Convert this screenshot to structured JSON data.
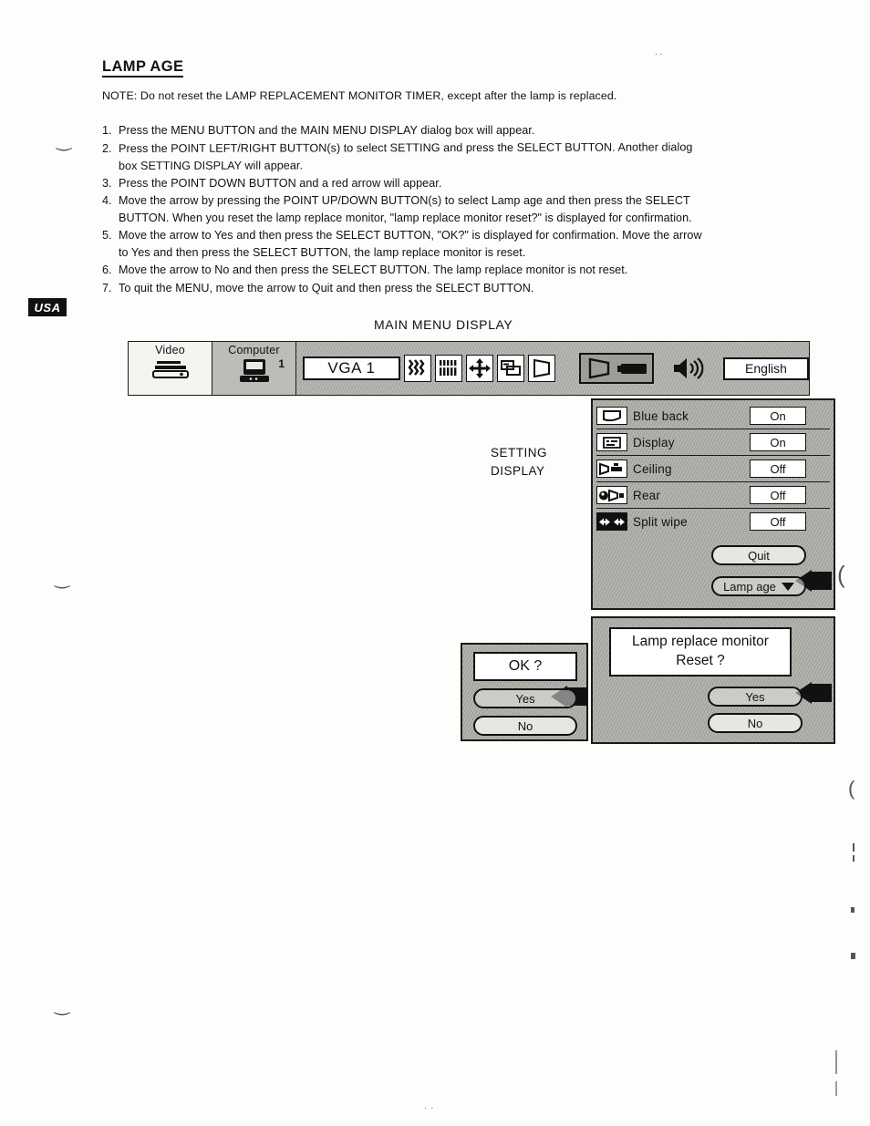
{
  "document": {
    "heading": "LAMP AGE",
    "note": "NOTE: Do not reset the LAMP REPLACEMENT MONITOR TIMER, except  after the lamp is replaced.",
    "region_badge": "USA",
    "top_artifact": ". .",
    "bottom_artifact": ". ."
  },
  "steps": [
    {
      "num": "1.",
      "lines": [
        "Press the MENU BUTTON and the MAIN MENU DISPLAY dialog box will appear."
      ]
    },
    {
      "num": "2.",
      "lines": [
        "Press the POINT LEFT/RIGHT BUTTON(s) to select SETTING and press the SELECT BUTTON. Another dialog",
        "box SETTING DISPLAY will appear."
      ]
    },
    {
      "num": "3.",
      "lines": [
        "Press the POINT DOWN BUTTON and a red arrow will appear."
      ]
    },
    {
      "num": "4.",
      "lines": [
        "Move the arrow by pressing the POINT UP/DOWN BUTTON(s) to select Lamp age and then press the SELECT",
        "BUTTON. When you reset the lamp replace monitor, \"lamp replace monitor reset?\" is displayed for confirmation."
      ]
    },
    {
      "num": "5.",
      "lines": [
        "Move the arrow to Yes and then press the SELECT BUTTON, \"OK?\" is displayed for confirmation. Move the arrow",
        "to Yes and then press the SELECT BUTTON, the lamp replace monitor is reset."
      ]
    },
    {
      "num": "6.",
      "lines": [
        "Move the arrow to No and then press the SELECT BUTTON. The lamp replace monitor is not reset."
      ]
    },
    {
      "num": "7.",
      "lines": [
        "To quit the MENU, move the arrow to Quit and then press the SELECT BUTTON."
      ]
    }
  ],
  "figure": {
    "title": "MAIN MENU DISPLAY",
    "setting_display_label_line1": "SETTING",
    "setting_display_label_line2": "DISPLAY",
    "menubar": {
      "tabs": [
        {
          "label": "Video",
          "icon": "video-deck-icon",
          "superscript": "",
          "selected": false
        },
        {
          "label": "Computer",
          "icon": "computer-monitor-icon",
          "superscript": "1",
          "selected": true
        }
      ],
      "source_value": "VGA 1",
      "icons": [
        {
          "name": "fine-sync-icon"
        },
        {
          "name": "total-dots-icon"
        },
        {
          "name": "position-icon"
        },
        {
          "name": "image-adjust-icon"
        },
        {
          "name": "screen-icon"
        }
      ],
      "setting_group_icons": [
        {
          "name": "projector-screen-icon"
        },
        {
          "name": "lamp-icon"
        }
      ],
      "sound_icon": "speaker-icon",
      "language_value": "English"
    },
    "setting_panel": {
      "rows": [
        {
          "icon": "blue-back-icon",
          "label": "Blue back",
          "value": "On",
          "inverted": false
        },
        {
          "icon": "display-icon",
          "label": "Display",
          "value": "On",
          "inverted": false
        },
        {
          "icon": "ceiling-icon",
          "label": "Ceiling",
          "value": "Off",
          "inverted": false
        },
        {
          "icon": "rear-icon",
          "label": "Rear",
          "value": "Off",
          "inverted": false
        },
        {
          "icon": "split-wipe-icon",
          "label": "Split wipe",
          "value": "Off",
          "inverted": true
        }
      ],
      "quit_label": "Quit",
      "lamp_age_label": "Lamp age"
    },
    "reset_dialog": {
      "message_line1": "Lamp replace monitor",
      "message_line2": "Reset ?",
      "yes_label": "Yes",
      "no_label": "No"
    },
    "ok_dialog": {
      "message": "OK ?",
      "yes_label": "Yes",
      "no_label": "No"
    }
  },
  "colors": {
    "ink": "#111111",
    "paper": "#fdfdfb",
    "panel_gray": "#b5b5b0",
    "menubar_gray": "#b9b9b4"
  }
}
